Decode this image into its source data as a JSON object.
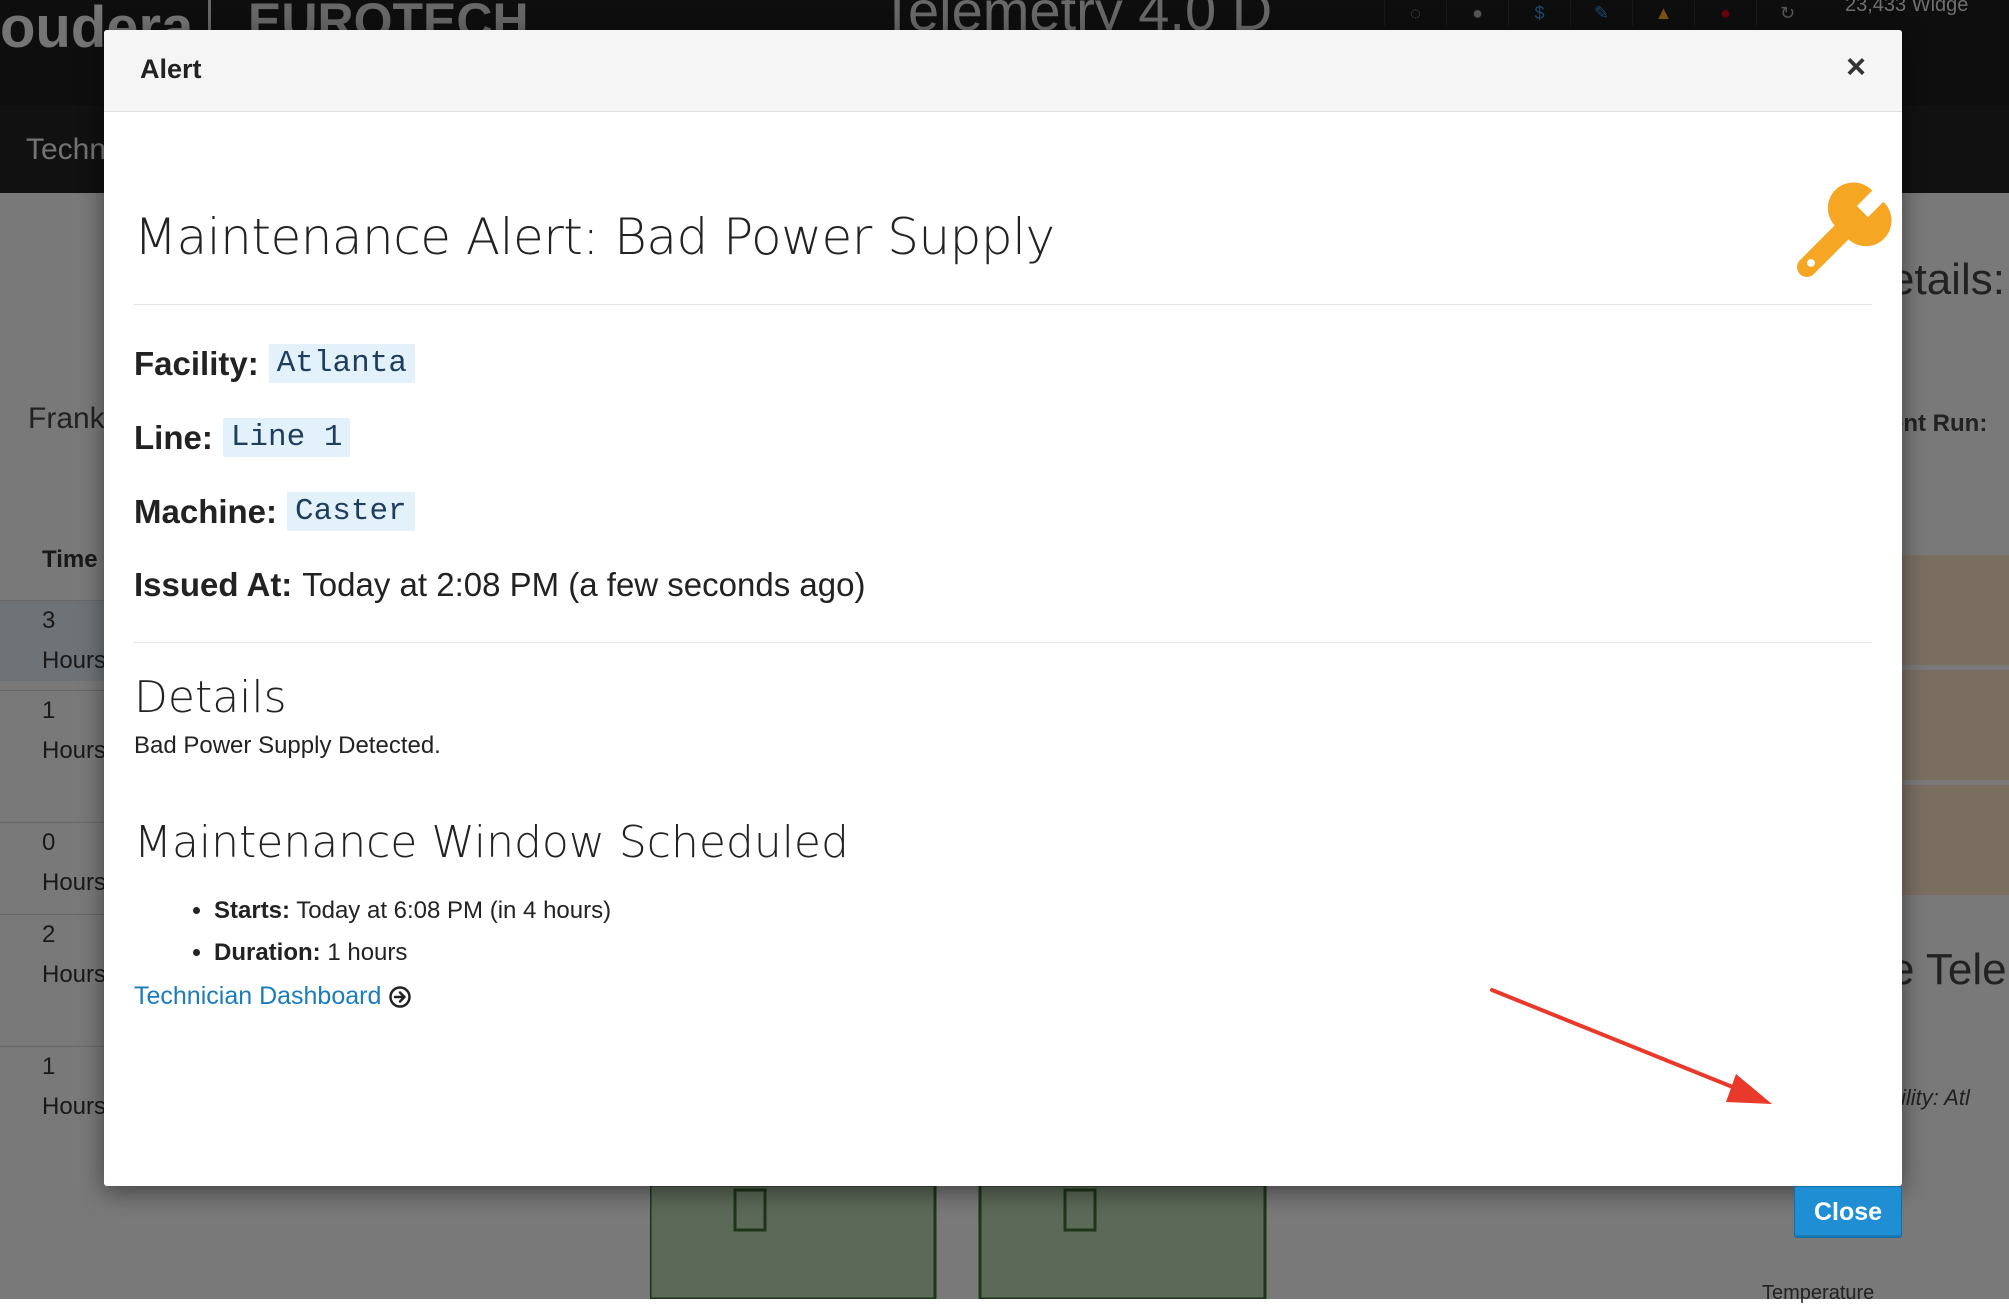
{
  "background": {
    "logo": "oudera",
    "logo_secondary": "EUROTECH",
    "app_title": "Telemetry 4.0 D",
    "widgets_count": "23,433 Widge",
    "nav_item": "Techn",
    "left_label": "Frankf",
    "table_header": "Time",
    "table_rows": [
      {
        "value": "3",
        "unit": "Hours"
      },
      {
        "value": "1",
        "unit": "Hours"
      },
      {
        "value": "0",
        "unit": "Hours"
      },
      {
        "value": "2",
        "unit": "Hours"
      },
      {
        "value": "1",
        "unit": "Hours"
      }
    ],
    "right_heading": "etails:",
    "right_label": "ent Run:",
    "right_heading2": "e Tele",
    "right_facility": "cility: Atl",
    "right_bottom": "Temperature"
  },
  "modal": {
    "title": "Alert",
    "close_x": "×",
    "heading": "Maintenance Alert: Bad Power Supply",
    "fields": {
      "facility_label": "Facility:",
      "facility_value": "Atlanta",
      "line_label": "Line:",
      "line_value": "Line 1",
      "machine_label": "Machine:",
      "machine_value": "Caster",
      "issued_label": "Issued At:",
      "issued_value": "Today at 2:08 PM (a few seconds ago)"
    },
    "details_heading": "Details",
    "details_text": "Bad Power Supply Detected.",
    "window_heading": "Maintenance Window Scheduled",
    "window_items": {
      "starts_label": "Starts:",
      "starts_value": "Today at 6:08 PM (in 4 hours)",
      "duration_label": "Duration:",
      "duration_value": "1 hours"
    },
    "link_label": "Technician Dashboard",
    "close_button": "Close"
  },
  "colors": {
    "accent": "#1f8ed3",
    "link": "#1a7bbd",
    "wrench": "#f5a623",
    "annotation_arrow": "#e8392a"
  },
  "icons": {
    "wrench": "wrench-icon",
    "arrow_circle": "arrow-circle-right-icon",
    "close": "close-icon"
  }
}
